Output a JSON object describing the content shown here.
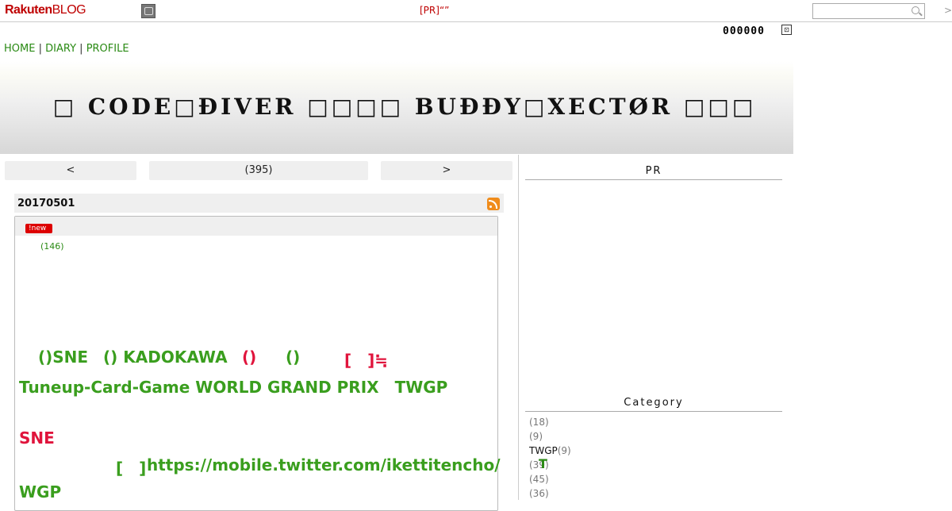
{
  "topbar": {
    "logo_main": "Rakuten",
    "logo_sub": "BLOG",
    "pr_text": "[PR]“”",
    "search_placeholder": "",
    "arrow": ">"
  },
  "counter": {
    "value": "000000"
  },
  "nav": {
    "home": "HOME",
    "diary": "DIARY",
    "profile": "PROFILE",
    "sep": "|"
  },
  "banner": {
    "title": "□ CODE□ĐIVER □□□□ BUĐĐY□XECTØR □□□"
  },
  "pager": {
    "prev": "<",
    "count": "(395)",
    "next": ">"
  },
  "entry": {
    "date": "20170501",
    "badge": "new",
    "comments": "(146)",
    "lines": [
      {
        "a": "()SNE",
        "b": "() KADOKAWA",
        "c": "()",
        "d": "()",
        "e": "[　]≒"
      },
      {
        "a": "Tuneup-Card-Game WORLD GRAND PRIX　TWGP"
      },
      {
        "a": "SNE"
      },
      {
        "a": "[　]",
        "b": "https://mobile.twitter.com/ikettitencho/"
      },
      {
        "a": "WGP"
      }
    ]
  },
  "sidebar": {
    "pr_heading": "PR",
    "category_heading": "Category",
    "categories": [
      {
        "name": "",
        "count": "(18)"
      },
      {
        "name": "",
        "count": "(9)"
      },
      {
        "name": "TWGP",
        "count": "(9)"
      },
      {
        "name": "",
        "count": "(39)"
      },
      {
        "name": "",
        "count": "(45)"
      },
      {
        "name": "",
        "count": "(36)"
      }
    ],
    "t_icon": "T"
  },
  "colors": {
    "brand": "#bf0000",
    "link": "#2a8a14",
    "accent_red": "#e0143c",
    "accent_green": "#3a9e1e"
  }
}
